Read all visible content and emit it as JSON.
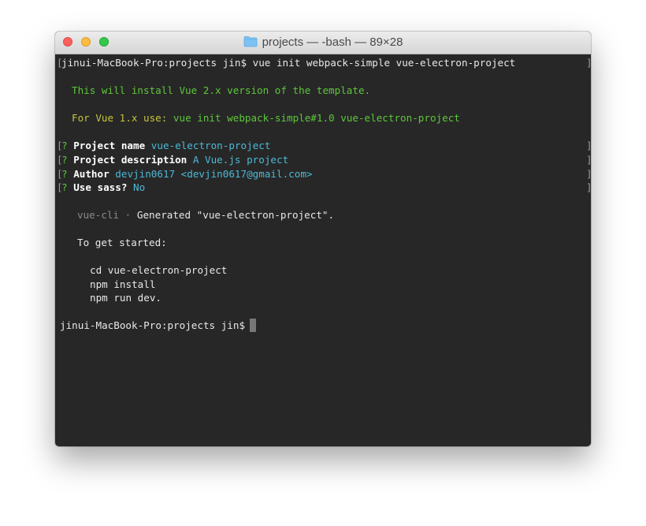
{
  "window": {
    "title": "projects — -bash — 89×28"
  },
  "terminal": {
    "cmd_line": {
      "prompt": "jinui-MacBook-Pro:projects jin$",
      "command": "vue init webpack-simple vue-electron-project"
    },
    "install_notice": "This will install Vue 2.x version of the template.",
    "vue1_label": "For Vue 1.x use:",
    "vue1_command": "vue init webpack-simple#1.0 vue-electron-project",
    "questions": [
      {
        "marker": "?",
        "label": "Project name",
        "answer": "vue-electron-project"
      },
      {
        "marker": "?",
        "label": "Project description",
        "answer": "A Vue.js project"
      },
      {
        "marker": "?",
        "label": "Author",
        "answer": "devjin0617 <devjin0617@gmail.com>"
      },
      {
        "marker": "?",
        "label": "Use sass?",
        "answer": "No"
      }
    ],
    "generated": {
      "tool": "vue-cli",
      "sep": "·",
      "text": "Generated \"vue-electron-project\"."
    },
    "get_started": "To get started:",
    "steps": [
      "cd vue-electron-project",
      "npm install",
      "npm run dev."
    ],
    "final_prompt": "jinui-MacBook-Pro:projects jin$"
  },
  "colors": {
    "terminal_bg": "#272727",
    "green": "#5ec73a",
    "yellow": "#c6c43d",
    "cyan": "#4cb9d6"
  },
  "icons": [
    "folder-icon"
  ]
}
